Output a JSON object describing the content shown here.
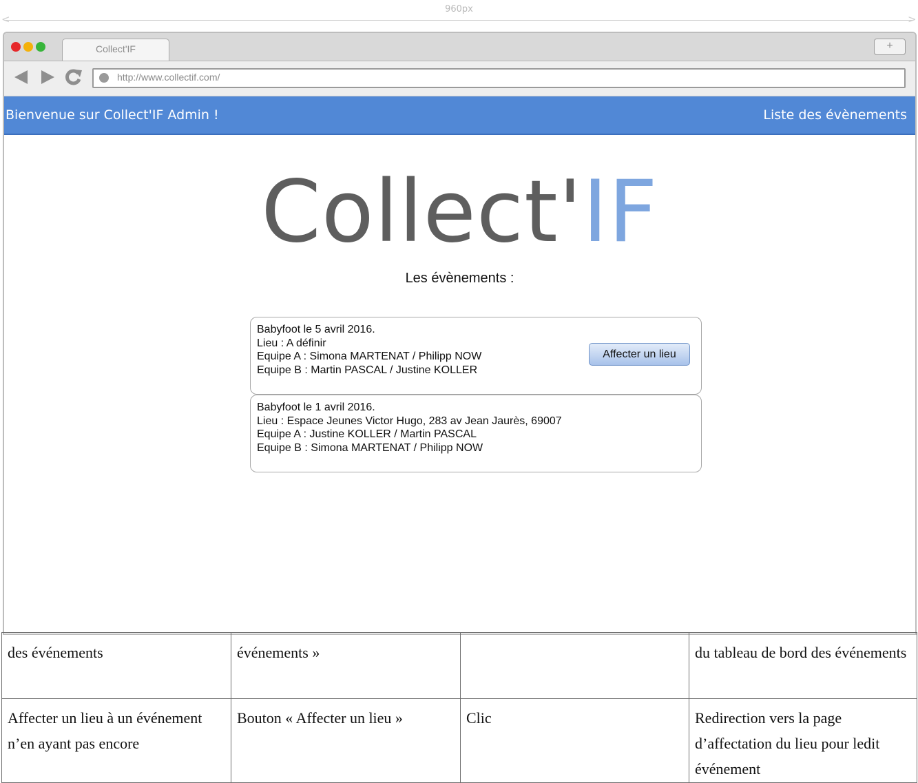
{
  "ruler": {
    "label": "960px"
  },
  "browser": {
    "tab_title": "Collect'IF",
    "new_tab": "+",
    "url": "http://www.collectif.com/"
  },
  "navbar": {
    "welcome": "Bienvenue sur Collect'IF Admin !",
    "events_link": "Liste des évènements"
  },
  "logo": {
    "main": "Collect'",
    "accent": "IF"
  },
  "section_title": "Les évènements :",
  "events": [
    {
      "line1": "Babyfoot le 5 avril 2016.",
      "line2": "Lieu : A définir",
      "line3": "Equipe A : Simona MARTENAT / Philipp NOW",
      "line4": "Equipe B : Martin PASCAL / Justine KOLLER",
      "button": "Affecter un lieu"
    },
    {
      "line1": "Babyfoot le 1 avril 2016.",
      "line2": "Lieu : Espace Jeunes Victor Hugo, 283 av Jean Jaurès, 69007",
      "line3": "Equipe A : Justine KOLLER / Martin PASCAL",
      "line4": "Equipe B : Simona MARTENAT / Philipp NOW"
    }
  ],
  "doc_table": {
    "rows": [
      [
        "des événements",
        "événements »",
        "",
        "du tableau de bord des événements"
      ],
      [
        "Affecter un lieu à un événement n’en ayant pas encore",
        "Bouton « Affecter un lieu »",
        "Clic",
        "Redirection vers la page d’affectation du lieu pour ledit événement"
      ]
    ]
  },
  "colors": {
    "navbar": "#5188d6",
    "logo_gray": "#5e5e5e",
    "logo_blue": "#7ea6df"
  },
  "icons": [
    "back-arrow-icon",
    "forward-arrow-icon",
    "reload-icon",
    "page-icon"
  ]
}
